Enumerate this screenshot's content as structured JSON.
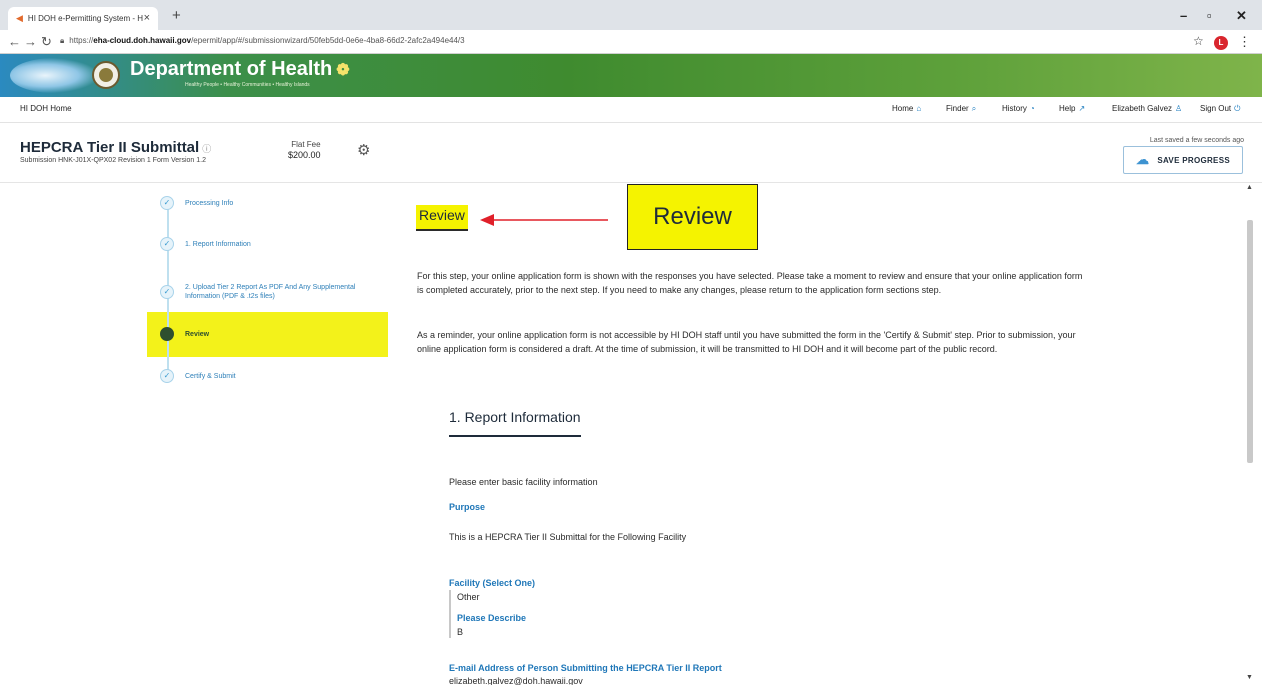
{
  "browser": {
    "tab_title": "HI DOH e-Permitting System - H",
    "tab_close": "×",
    "new_tab": "+",
    "url_prefix": "https://",
    "url_host": "eha-cloud.doh.hawaii.gov",
    "url_path": "/epermit/app/#/submissionwizard/50feb5dd-0e6e-4ba8-66d2-2afc2a494e44/3",
    "profile_initial": "L",
    "icons": [
      "back-arrow-icon",
      "forward-arrow-icon",
      "reload-icon",
      "lock-icon",
      "star-icon",
      "kebab-menu-icon"
    ]
  },
  "banner": {
    "department": "Department of Health",
    "tagline": "Healthy People • Healthy Communities • Healthy Islands"
  },
  "appnav": {
    "home": "HI DOH Home",
    "links": [
      {
        "label": "Home",
        "icon": "house-icon"
      },
      {
        "label": "Finder",
        "icon": "search-icon"
      },
      {
        "label": "History",
        "icon": "history-icon"
      },
      {
        "label": "Help",
        "icon": "external-link-icon"
      },
      {
        "label": "Elizabeth Galvez",
        "icon": "user-icon"
      },
      {
        "label": "Sign Out",
        "icon": "power-icon"
      }
    ]
  },
  "form": {
    "title": "HEPCRA Tier II Submittal",
    "info_symbol": "ⓘ",
    "subtitle": "Submission HNK-J01X-QPX02   Revision 1   Form Version 1.2",
    "fee_label": "Flat Fee",
    "fee_amount": "$200.00",
    "last_saved": "Last saved a few seconds ago",
    "save_button": "SAVE PROGRESS"
  },
  "steps": [
    {
      "label": "Processing Info",
      "state": "complete"
    },
    {
      "label": "1. Report Information",
      "state": "complete"
    },
    {
      "label": "2. Upload Tier 2 Report As PDF And Any Supplemental Information (PDF & .t2s files)",
      "state": "complete"
    },
    {
      "label": "Review",
      "state": "current"
    },
    {
      "label": "Certify & Submit",
      "state": "upcoming"
    }
  ],
  "step_check": "✓",
  "main": {
    "heading": "Review",
    "callout": "Review",
    "paragraph1": "For this step, your online application form is shown with the responses you have selected. Please take a moment to review and ensure that your online application form is completed accurately, prior to the next step. If you need to make any changes, please return to the application form sections step.",
    "paragraph2": "As a reminder, your online application form is not accessible by HI DOH staff until you have submitted the form in the 'Certify & Submit' step. Prior to submission, your online application form is considered a draft. At the time of submission, it will be transmitted to HI DOH and it will become part of the public record.",
    "section_title": "1. Report Information",
    "section_intro": "Please enter basic facility information",
    "purpose_label": "Purpose",
    "purpose_text": "This is a HEPCRA Tier II Submittal for the Following Facility",
    "facility_label": "Facility (Select One)",
    "facility_value": "Other",
    "describe_label": "Please Describe",
    "describe_value": "B",
    "email_label": "E-mail Address of Person Submitting the HEPCRA Tier II Report",
    "email_value": "elizabeth.galvez@doh.hawaii.gov"
  },
  "colors": {
    "highlight": "#f5f300",
    "accent_blue": "#1f77b8",
    "arrow_red": "#e0202a",
    "step_active": "#2f4f2f"
  }
}
